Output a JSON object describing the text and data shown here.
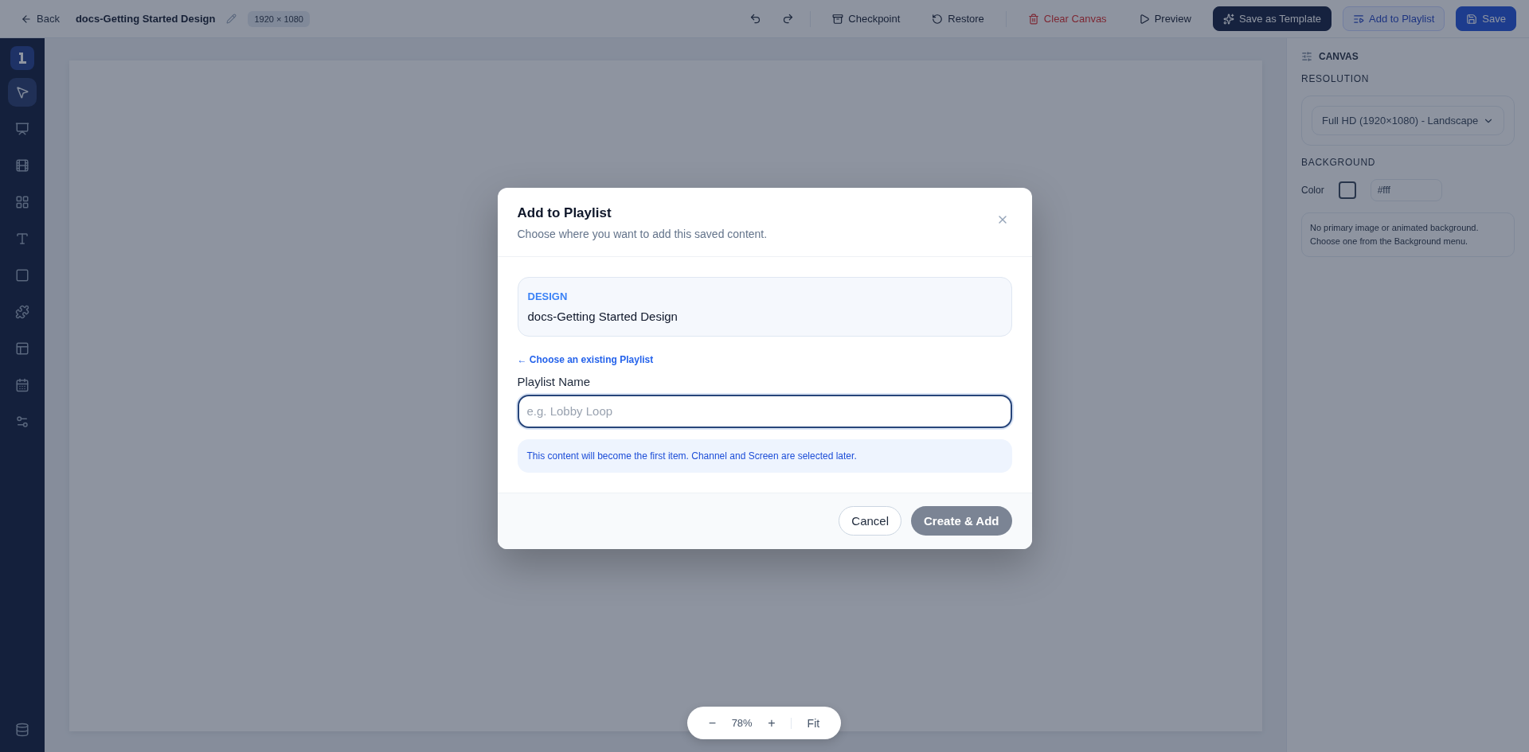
{
  "topbar": {
    "back": "Back",
    "title": "docs-Getting Started Design",
    "size": "1920 × 1080",
    "actions": [
      {
        "label": "Checkpoint",
        "kind": "plain"
      },
      {
        "label": "Restore",
        "kind": "plain"
      },
      {
        "label": "Clear Canvas",
        "kind": "danger"
      },
      {
        "label": "Preview",
        "kind": "plain"
      },
      {
        "label": "Save as Template",
        "kind": "dark"
      },
      {
        "label": "Add to Playlist",
        "kind": "outline"
      },
      {
        "label": "Save",
        "kind": "primary"
      }
    ]
  },
  "sidebar": {
    "tools": [
      {
        "selected": true
      },
      {
        "selected": false
      },
      {
        "selected": false
      },
      {
        "selected": false
      },
      {
        "selected": false
      },
      {
        "selected": false
      },
      {
        "selected": false
      },
      {
        "selected": false
      },
      {
        "selected": false
      },
      {
        "selected": false
      }
    ]
  },
  "panel": {
    "title": "CANVAS",
    "resolution_label": "RESOLUTION",
    "resolution": "Full HD (1920×1080) - Landscape",
    "background_label": "BACKGROUND",
    "color_label": "Color",
    "color_value": "#fff",
    "note": "No primary image or animated background. Choose one from the Background menu."
  },
  "dialog": {
    "title": "Add to Playlist",
    "subtitle": "Choose where you want to add this saved content.",
    "content_type": "DESIGN",
    "content_name": "docs-Getting Started Design",
    "back_link": "← Choose an existing Playlist",
    "field_label": "Playlist Name",
    "placeholder": "e.g. Lobby Loop",
    "info": "This content will become the first item. Channel and Screen are selected later.",
    "buttons": [
      {
        "label": "Cancel",
        "kind": "secondary",
        "disabled": false
      },
      {
        "label": "Create & Add",
        "kind": "primary",
        "disabled": true
      }
    ]
  },
  "zoom": {
    "minus": "−",
    "value": "78%",
    "plus": "+",
    "fit": "Fit"
  }
}
